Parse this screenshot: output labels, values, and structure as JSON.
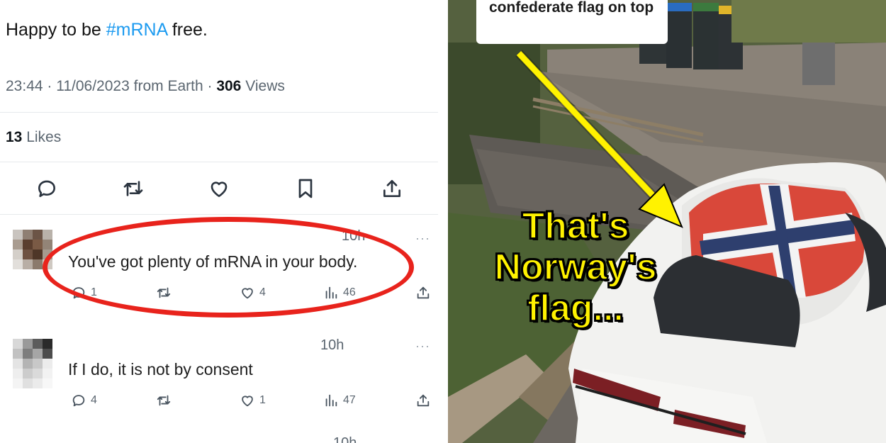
{
  "tweet": {
    "text_prefix": "Happy to be ",
    "hashtag": "#mRNA",
    "text_suffix": " free.",
    "time": "23:44",
    "date": "11/06/2023",
    "source": "from Earth",
    "views_count": "306",
    "views_label": "Views",
    "likes_count": "13",
    "likes_label": "Likes"
  },
  "replies": [
    {
      "time": "10h",
      "text": "You've got plenty of mRNA in your body.",
      "replies": "1",
      "likes": "4",
      "views": "46"
    },
    {
      "time": "10h",
      "text": "If I do, it is not by consent",
      "replies": "4",
      "likes": "1",
      "views": "47"
    },
    {
      "time": "10h"
    }
  ],
  "photo": {
    "caption": "confederate flag on top",
    "overlay": "That's Norway's flag..."
  },
  "colors": {
    "link": "#1d9bf0",
    "highlight_circle": "#e8231c",
    "overlay_text": "#fff200",
    "arrow": "#fff200"
  },
  "icons": [
    "reply-icon",
    "retweet-icon",
    "like-icon",
    "bookmark-icon",
    "share-icon",
    "views-icon",
    "more-icon"
  ]
}
